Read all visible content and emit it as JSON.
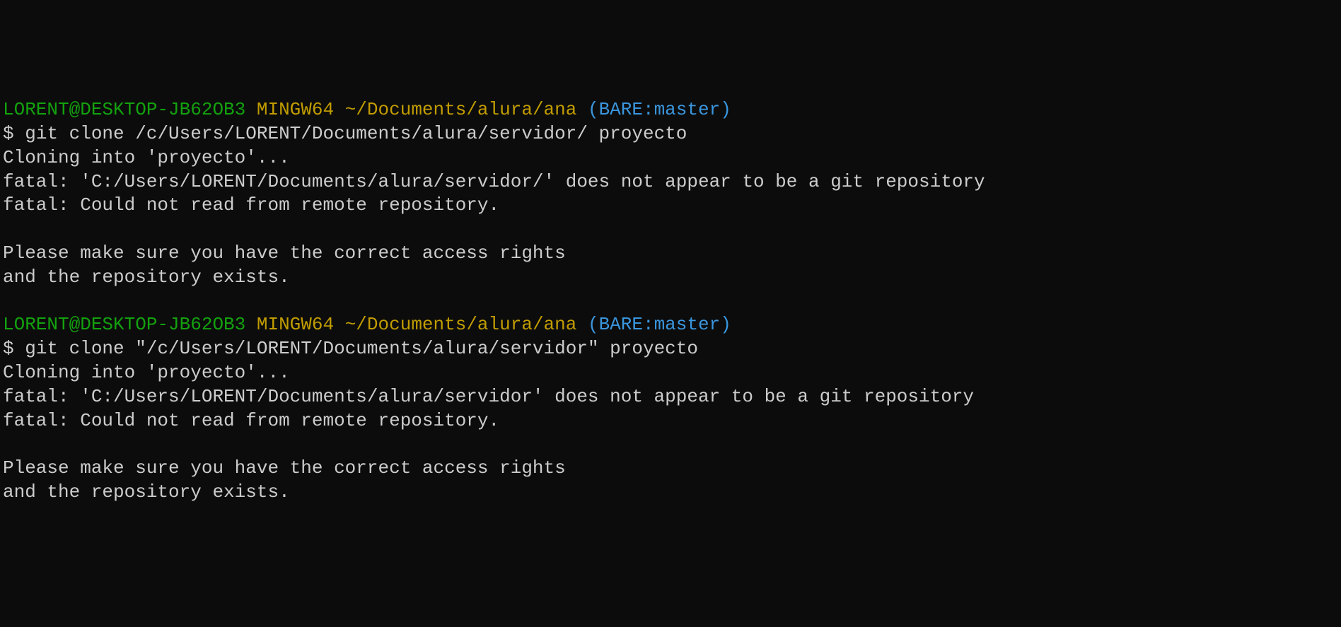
{
  "block1": {
    "prompt": {
      "user_host": "LORENT@DESKTOP-JB62OB3",
      "env": "MINGW64",
      "path": "~/Documents/alura/ana",
      "branch": "(BARE:master)"
    },
    "command_prefix": "$ ",
    "command": "git clone /c/Users/LORENT/Documents/alura/servidor/ proyecto",
    "output": [
      "Cloning into 'proyecto'...",
      "fatal: 'C:/Users/LORENT/Documents/alura/servidor/' does not appear to be a git repository",
      "fatal: Could not read from remote repository.",
      "",
      "Please make sure you have the correct access rights",
      "and the repository exists."
    ]
  },
  "block2": {
    "prompt": {
      "user_host": "LORENT@DESKTOP-JB62OB3",
      "env": "MINGW64",
      "path": "~/Documents/alura/ana",
      "branch": "(BARE:master)"
    },
    "command_prefix": "$ ",
    "command": "git clone \"/c/Users/LORENT/Documents/alura/servidor\" proyecto",
    "output": [
      "Cloning into 'proyecto'...",
      "fatal: 'C:/Users/LORENT/Documents/alura/servidor' does not appear to be a git repository",
      "fatal: Could not read from remote repository.",
      "",
      "Please make sure you have the correct access rights",
      "and the repository exists."
    ]
  }
}
